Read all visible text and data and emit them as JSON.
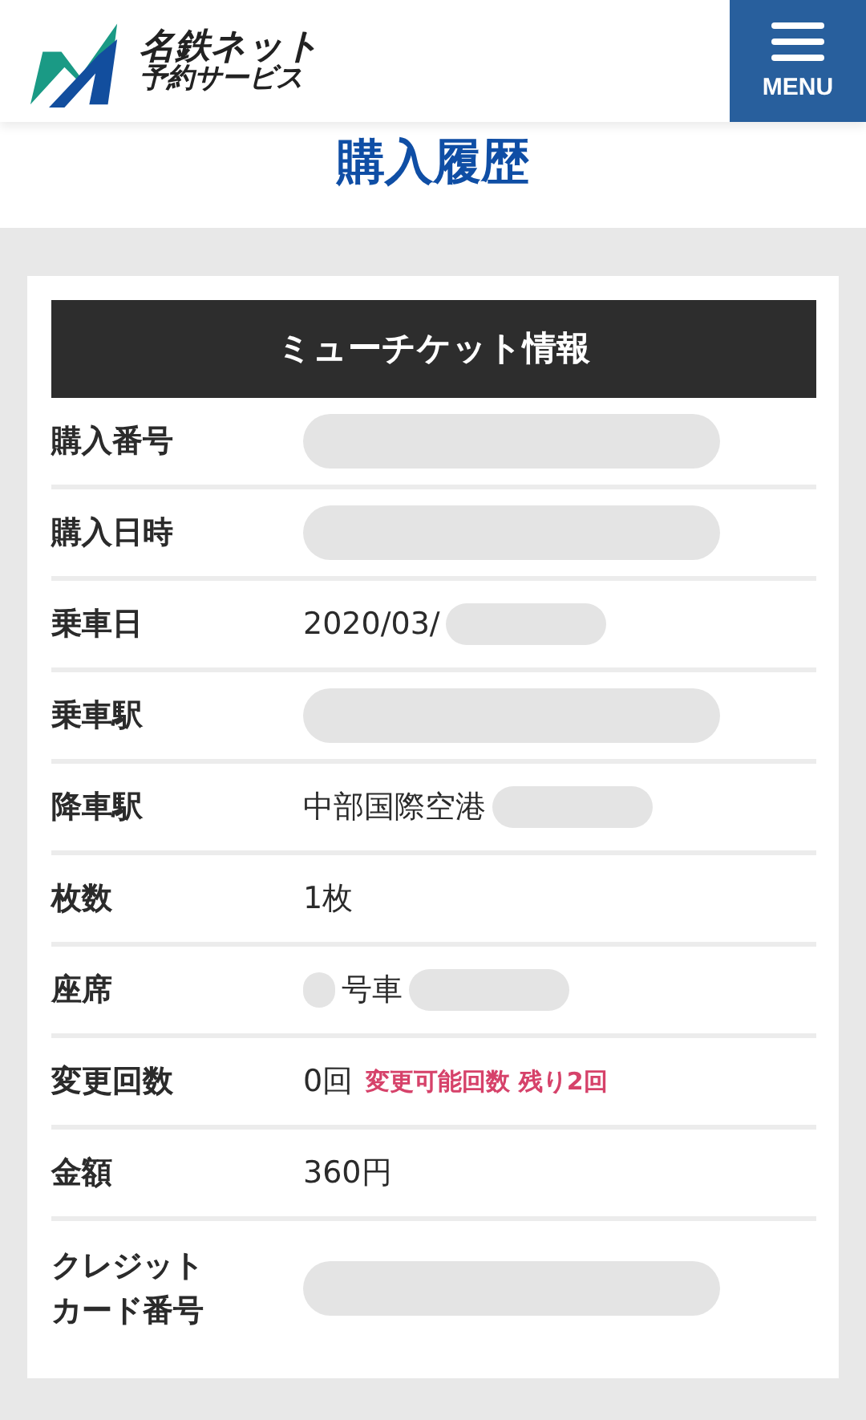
{
  "header": {
    "logo_line1": "名鉄ネット",
    "logo_line2": "予約サービス",
    "menu_label": "MENU"
  },
  "page_title": "購入履歴",
  "card": {
    "heading": "ミューチケット情報",
    "rows": [
      {
        "label": "購入番号",
        "value": "",
        "hidden_before": false,
        "hidden_after": true
      },
      {
        "label": "購入日時",
        "value": "",
        "hidden_before": false,
        "hidden_after": true
      },
      {
        "label": "乗車日",
        "value": "2020/03/",
        "hidden_before": false,
        "hidden_after": true
      },
      {
        "label": "乗車駅",
        "value": "",
        "hidden_before": false,
        "hidden_after": true
      },
      {
        "label": "降車駅",
        "value": "中部国際空港",
        "hidden_before": false,
        "hidden_after": true
      },
      {
        "label": "枚数",
        "value": "1枚",
        "hidden_before": false,
        "hidden_after": false
      },
      {
        "label": "座席",
        "value": "号車",
        "hidden_before": true,
        "hidden_after": true
      },
      {
        "label": "変更回数",
        "value": "0回",
        "note": "変更可能回数 残り2回",
        "hidden_before": false,
        "hidden_after": false
      },
      {
        "label": "金額",
        "value": "360円",
        "hidden_before": false,
        "hidden_after": false
      },
      {
        "label": "クレジットカード番号",
        "value": "",
        "hidden_before": false,
        "hidden_after": true
      }
    ]
  }
}
